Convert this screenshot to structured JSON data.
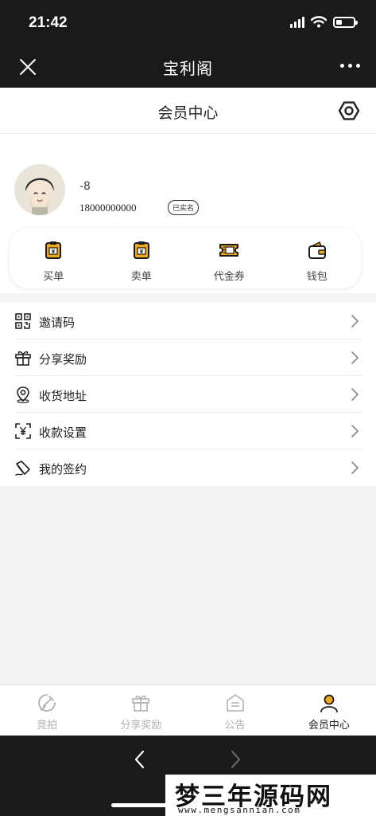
{
  "status_bar": {
    "time": "21:42"
  },
  "app_bar": {
    "title": "宝利阁"
  },
  "page": {
    "title": "会员中心"
  },
  "profile": {
    "name": "-8",
    "phone": "18000000000",
    "badge": "已实名"
  },
  "quick_actions": [
    {
      "label": "买单",
      "icon": "clipboard-icon"
    },
    {
      "label": "卖单",
      "icon": "clipboard-icon"
    },
    {
      "label": "代金券",
      "icon": "voucher-icon"
    },
    {
      "label": "钱包",
      "icon": "wallet-icon"
    }
  ],
  "menu": [
    {
      "label": "邀请码",
      "icon": "qr-code-icon"
    },
    {
      "label": "分享奖励",
      "icon": "gift-icon"
    },
    {
      "label": "收货地址",
      "icon": "location-icon"
    },
    {
      "label": "收款设置",
      "icon": "yen-scan-icon"
    },
    {
      "label": "我的签约",
      "icon": "sign-icon"
    }
  ],
  "tabs": [
    {
      "label": "竞拍",
      "icon": "auction-icon",
      "active": false
    },
    {
      "label": "分享奖励",
      "icon": "gift-icon",
      "active": false
    },
    {
      "label": "公告",
      "icon": "notice-icon",
      "active": false
    },
    {
      "label": "会员中心",
      "icon": "user-icon",
      "active": true
    }
  ],
  "watermark": {
    "title": "梦三年源码网",
    "url": "www.mengsannian.com"
  },
  "colors": {
    "accent": "#f0a91c",
    "dark": "#1a1a1a",
    "background": "#f4f4f4",
    "inactive_tab": "#b0b0b0"
  }
}
